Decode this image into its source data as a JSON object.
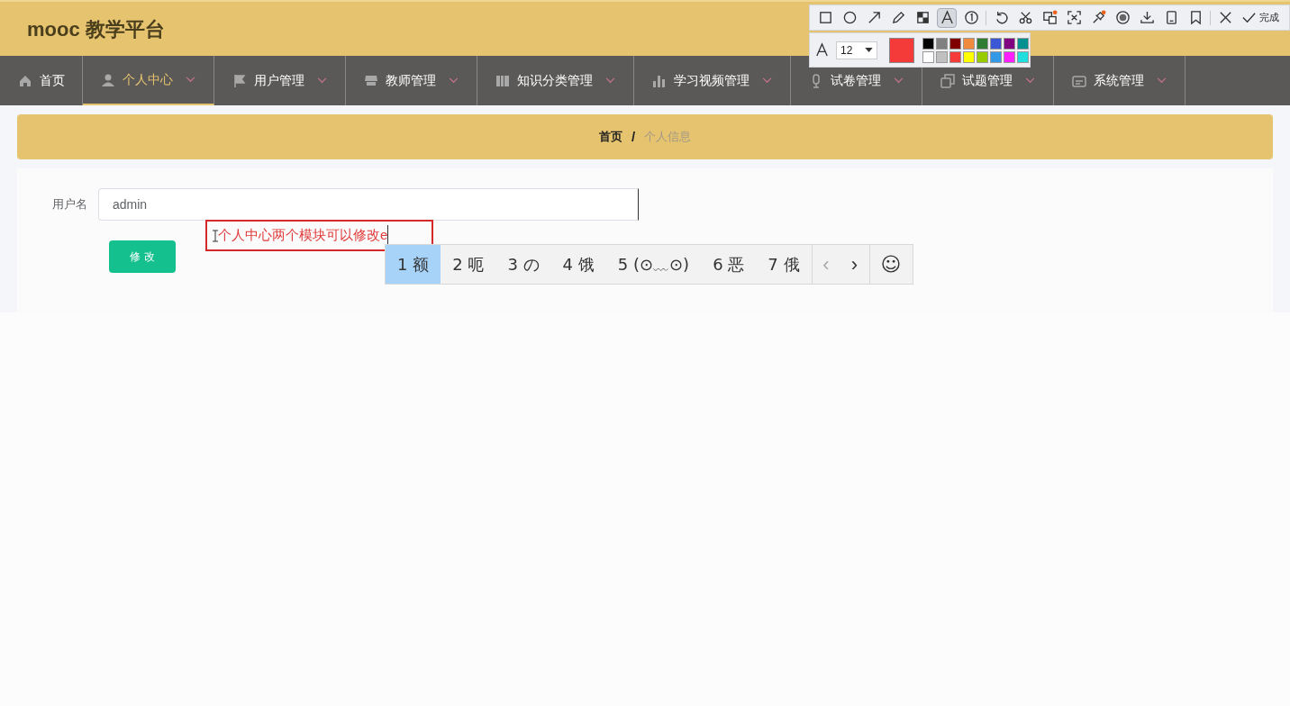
{
  "header": {
    "title": "mooc 教学平台"
  },
  "nav": [
    {
      "label": "首页",
      "dropdown": false,
      "selected": false
    },
    {
      "label": "个人中心",
      "dropdown": true,
      "selected": true
    },
    {
      "label": "用户管理",
      "dropdown": true,
      "selected": false
    },
    {
      "label": "教师管理",
      "dropdown": true,
      "selected": false
    },
    {
      "label": "知识分类管理",
      "dropdown": true,
      "selected": false
    },
    {
      "label": "学习视频管理",
      "dropdown": true,
      "selected": false
    },
    {
      "label": "试卷管理",
      "dropdown": true,
      "selected": false
    },
    {
      "label": "试题管理",
      "dropdown": true,
      "selected": false
    },
    {
      "label": "系统管理",
      "dropdown": true,
      "selected": false
    }
  ],
  "breadcrumb": [
    "首页",
    "/",
    "个人信息"
  ],
  "form": {
    "label": "用户名",
    "value": "admin",
    "button": "修 改"
  },
  "annotation": {
    "text": "个人中心两个模块可以修改e"
  },
  "ime": {
    "candidates": [
      {
        "label": "1 额",
        "selected": true
      },
      {
        "label": "2 呃",
        "selected": false
      },
      {
        "label": "3 の",
        "selected": false
      },
      {
        "label": "4 饿",
        "selected": false
      },
      {
        "label": "5 (⊙﹏⊙)",
        "selected": false
      },
      {
        "label": "6 恶",
        "selected": false
      },
      {
        "label": "7 俄",
        "selected": false
      }
    ],
    "prev": "‹",
    "next": "›",
    "emoji": "☺"
  },
  "toolbar": {
    "tools": [
      {
        "selected": false
      },
      {
        "selected": false
      },
      {
        "selected": false
      },
      {
        "selected": false
      },
      {
        "selected": false
      },
      {
        "selected": true
      },
      {
        "selected": false
      },
      {
        "selected": false
      },
      {
        "selected": false
      },
      {
        "selected": false
      },
      {
        "selected": false
      },
      {
        "selected": false
      },
      {
        "selected": false
      },
      {
        "selected": false
      },
      {
        "selected": false
      },
      {
        "selected": false
      },
      {
        "selected": false
      }
    ],
    "done": "完成",
    "font_size": "12",
    "current": {
      "color": "#f53a3a"
    },
    "palette": [
      {
        "color": "#000000"
      },
      {
        "color": "#808080"
      },
      {
        "color": "#800000"
      },
      {
        "color": "#f08a3c"
      },
      {
        "color": "#2e7d32"
      },
      {
        "color": "#3b57d6"
      },
      {
        "color": "#800080"
      },
      {
        "color": "#009090"
      },
      {
        "color": "#ffffff"
      },
      {
        "color": "#c0c0c0"
      },
      {
        "color": "#f53a3a"
      },
      {
        "color": "#ffff00"
      },
      {
        "color": "#99cc00"
      },
      {
        "color": "#3399e6"
      },
      {
        "color": "#ff20ff"
      },
      {
        "color": "#20dede"
      }
    ]
  }
}
